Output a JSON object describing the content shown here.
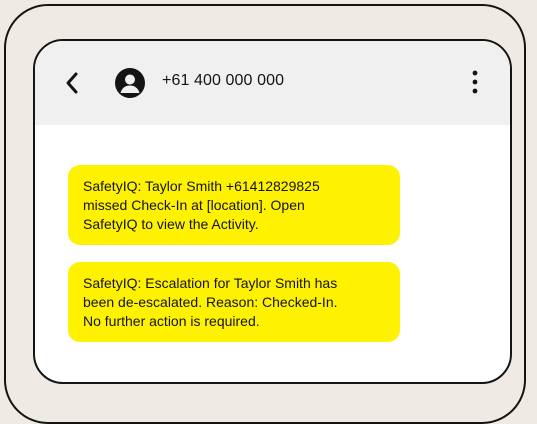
{
  "conversation": {
    "contact_number": "+61 400 000 000"
  },
  "messages": [
    {
      "text": "SafetyIQ: Taylor Smith +61412829825\nmissed Check-In at [location]. Open\nSafetyIQ to view the Activity."
    },
    {
      "text": "SafetyIQ: Escalation for Taylor Smith has\nbeen de-escalated. Reason: Checked-In.\nNo further action is required."
    }
  ],
  "colors": {
    "bubble_background": "#fff200",
    "header_background": "#f0f0f0",
    "page_background": "#efeae4",
    "frame_stroke": "#141414"
  },
  "icons": {
    "back": "chevron-left",
    "avatar": "person-circle",
    "more": "vertical-ellipsis"
  }
}
